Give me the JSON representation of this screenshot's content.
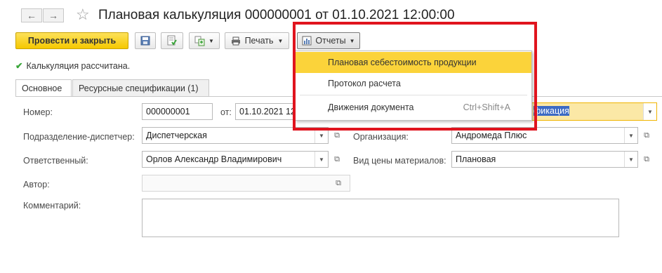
{
  "header": {
    "title": "Плановая калькуляция 000000001 от 01.10.2021 12:00:00",
    "back_glyph": "←",
    "forward_glyph": "→",
    "star_glyph": "☆"
  },
  "toolbar": {
    "post_close_label": "Провести и закрыть",
    "print_label": "Печать",
    "reports_label": "Отчеты"
  },
  "status": {
    "message": "Калькуляция рассчитана."
  },
  "tabs": [
    {
      "label": "Основное",
      "active": true
    },
    {
      "label": "Ресурсные спецификации (1)",
      "active": false
    }
  ],
  "form": {
    "number_label": "Номер:",
    "number_value": "000000001",
    "date_label": "от:",
    "date_value": "01.10.2021 12",
    "type_value": "фикация",
    "dispatcher_label": "Подразделение-диспетчер:",
    "dispatcher_value": "Диспетчерская",
    "organization_label": "Организация:",
    "organization_value": "Андромеда Плюс",
    "responsible_label": "Ответственный:",
    "responsible_value": "Орлов Александр Владимирович",
    "price_type_label": "Вид цены материалов:",
    "price_type_value": "Плановая",
    "author_label": "Автор:",
    "author_value": "",
    "comment_label": "Комментарий:",
    "comment_value": ""
  },
  "reports_menu": {
    "items": [
      {
        "label": "Плановая себестоимость продукции",
        "shortcut": "",
        "highlighted": true
      },
      {
        "label": "Протокол расчета",
        "shortcut": "",
        "highlighted": false
      },
      {
        "label": "Движения документа",
        "shortcut": "Ctrl+Shift+A",
        "highlighted": false
      }
    ]
  },
  "colors": {
    "primary_button": "#f5c800",
    "highlight": "#fbd33a",
    "callout_border": "#e0141e",
    "status_check": "#3aa63a"
  },
  "icons": {
    "save": "save-icon",
    "post": "post-document-icon",
    "structure": "document-structure-icon",
    "print": "printer-icon",
    "reports": "report-icon",
    "open": "open-form-icon",
    "dropdown": "chevron-down-icon",
    "success": "checkmark-icon"
  }
}
